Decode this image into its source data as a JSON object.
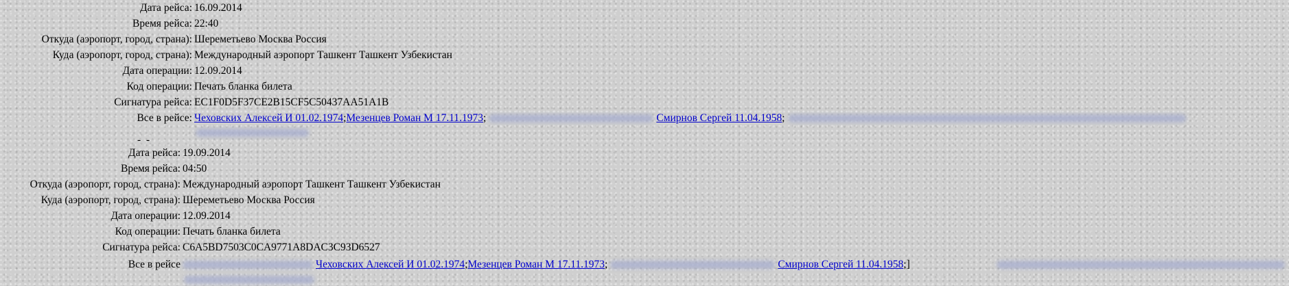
{
  "records": [
    {
      "fields": [
        {
          "label": "Дата рейса:",
          "value": "16.09.2014"
        },
        {
          "label": "Время рейса:",
          "value": "22:40"
        },
        {
          "label": "Откуда (аэропорт, город, страна):",
          "value": "Шереметьево Москва Россия"
        },
        {
          "label": "Куда (аэропорт, город, страна):",
          "value": "Международный аэропорт Ташкент Ташкент Узбекистан"
        },
        {
          "label": "Дата операции:",
          "value": "12.09.2014"
        },
        {
          "label": "Код операции:",
          "value": "Печать бланка билета"
        },
        {
          "label": "Сигнатура рейса:",
          "value": "EC1F0D5F37CE2B15CF5C50437AA51A1B"
        }
      ],
      "passengers_label": "Все в рейсе:",
      "passengers": [
        "Чеховских Алексей И 01.02.1974",
        "Мезенцев Роман М 17.11.1973",
        "Смирнов Сергей 11.04.1958"
      ],
      "separator": ";"
    },
    {
      "fields": [
        {
          "label": "Дата рейса:",
          "value": "19.09.2014"
        },
        {
          "label": "Время рейса:",
          "value": "04:50"
        },
        {
          "label": "Откуда (аэропорт, город, страна):",
          "value": "Международный аэропорт Ташкент Ташкент Узбекистан"
        },
        {
          "label": "Куда (аэропорт, город, страна):",
          "value": "Шереметьево Москва Россия"
        },
        {
          "label": "Дата операции:",
          "value": "12.09.2014"
        },
        {
          "label": "Код операции:",
          "value": "Печать бланка билета"
        },
        {
          "label": "Сигнатура рейса:",
          "value": "C6A5BD7503C0CA9771A8DAC3C93D6527"
        }
      ],
      "passengers_label": "Все в рейсе",
      "passengers": [
        "Чеховских Алексей И 01.02.1974",
        "Мезенцев Роман М 17.11.1973",
        "Смирнов Сергей 11.04.1958"
      ],
      "separator": ";",
      "trailing": "]"
    }
  ],
  "record_separator": "- -"
}
